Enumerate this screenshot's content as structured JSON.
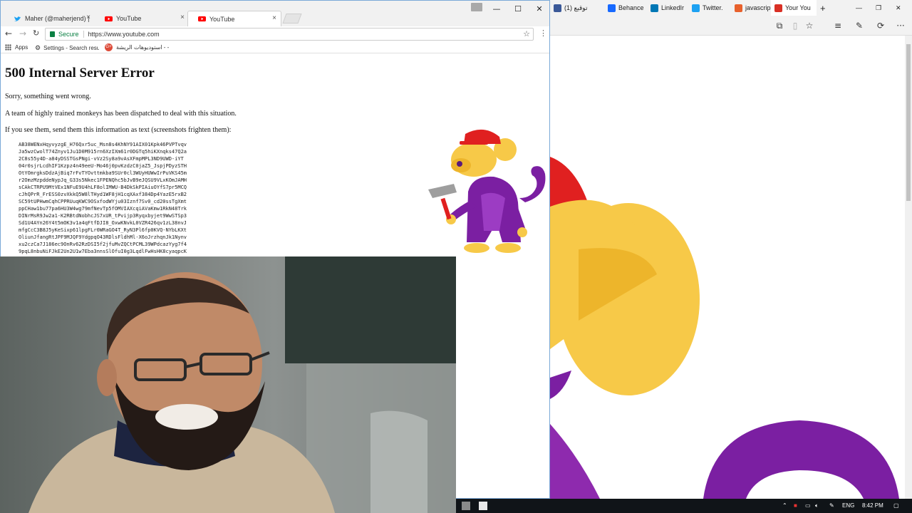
{
  "edge": {
    "tabs": [
      {
        "label": "(1) توقيع",
        "color": "#3b5998"
      },
      {
        "label": "Behance",
        "color": "#1769ff"
      },
      {
        "label": "LinkedIr",
        "color": "#0077b5"
      },
      {
        "label": "Twitter.",
        "color": "#1da1f2"
      },
      {
        "label": "javascrip",
        "color": "#e8612c"
      },
      {
        "label": "Your You",
        "color": "#d93025"
      }
    ],
    "new_tab": "+",
    "win_min": "—",
    "win_restore": "❐",
    "win_close": "✕"
  },
  "chrome": {
    "tabs": [
      {
        "label": "Maher (@maherjend) | T",
        "icon": "twitter-icon"
      },
      {
        "label": "YouTube",
        "icon": "youtube-icon"
      },
      {
        "label": "YouTube",
        "icon": "youtube-icon"
      }
    ],
    "close_glyph": "×",
    "win_min": "—",
    "win_max": "☐",
    "win_close": "✕",
    "secure_label": "Secure",
    "url": "https://www.youtube.com",
    "bookmarks": [
      {
        "label": "Apps",
        "icon": "apps-grid-icon"
      },
      {
        "label": "Settings - Search resu",
        "icon": "gear-icon"
      },
      {
        "label": "استوديوهات الريشة - -",
        "icon": "google-plus-icon"
      }
    ]
  },
  "page": {
    "title": "500 Internal Server Error",
    "line1": "Sorry, something went wrong.",
    "line2": "A team of highly trained monkeys has been dispatched to deal with this situation.",
    "line3": "If you see them, send them this information as text (screenshots frighten them):",
    "code_lines": [
      "AB38WENxHqyvyzgE_H76Qxr5uc_Msn8s4KhNY91AIX01Kpk46PVPTvqv",
      "Ja5wzCwolT74Znyv1Ju1D0M915rn6XzIXm61r0DGTq5hiKXnqks47Q2a",
      "2C8s55y4D-a84yDSSTGsPNgi-vVz2Sy8a9vAsXFmpMPL3ND9UWD-iYT",
      "04r0sjrLcdhIF1Kzpz4n49eeU-Mo46j0pvKzdzC0jaZ5_JspjPDyzSTH",
      "OtYOmrgksDdzAjBiq7rFvTYOvttmkba9SUr0cl3WUyHUWwIrPuVKS45m",
      "r2OmzMzpddeNypJq_G33s5Nkec1FPENQhc5bJvB9eJQSU9VLxKOmJAMH",
      "sCAkCTRPU9MtVEx1NFuE9U4hLF8olIMWU-B4DkSkPIAiuOYfS7pr5MCQ",
      "cJhQPrR_FrESS0zvXkkQ5W8lTHyd1WF8jH1cqXAxf384Dp4YazE5rxB2",
      "SC59tUPHwmCqhCPPRUuqKWC9OSxfodWYju03Iznf7Sv0_cd20ssTgXmt",
      "ppCHaw1bu77pa6HU3W4wg79mfNevTp5fOMVIAXcqiAVaKmw1RkN48Trk",
      "DINrMsR9Jw2a1-K2RBtdNobhcJS7xUR_tPvijp3Ryqxbyjet9WwSTSp3",
      "Sd1U4AYn26Y4t5mOK3v1a4qFtfDJI8_OxwKNvkL0VZR426qv1zL38nvJ",
      "mfgCcC3B8J5yKeSixp61lpgFLr0WRaGO4T_RyN3Pl6fp0KVQ-NYbLKXt",
      "OliunJfangRtJPF9MJQF9YdgpqO43RDlsFldhMl-X6oJrzhqnJk1Nynv",
      "xu2czCa7J186ec9OnRv62RzDSI5f2jfuMvZQCtPCML39WPdcazYyg7f4",
      "9pqL8nbuNiFJkE2Un2U1w7Eba3nnsSlOfuI0g3LqdlFwHsHK8cyaqpcK"
    ]
  },
  "taskbar": {
    "lang": "ENG",
    "time": "8:42 PM"
  },
  "colors": {
    "edge_bg": "#f2f2f2",
    "chrome_border": "#7aa9d8",
    "secure_green": "#0b8043",
    "youtube_red": "#ff0000",
    "monkey_purple": "#7b1fa2",
    "monkey_yellow": "#f7c948"
  }
}
